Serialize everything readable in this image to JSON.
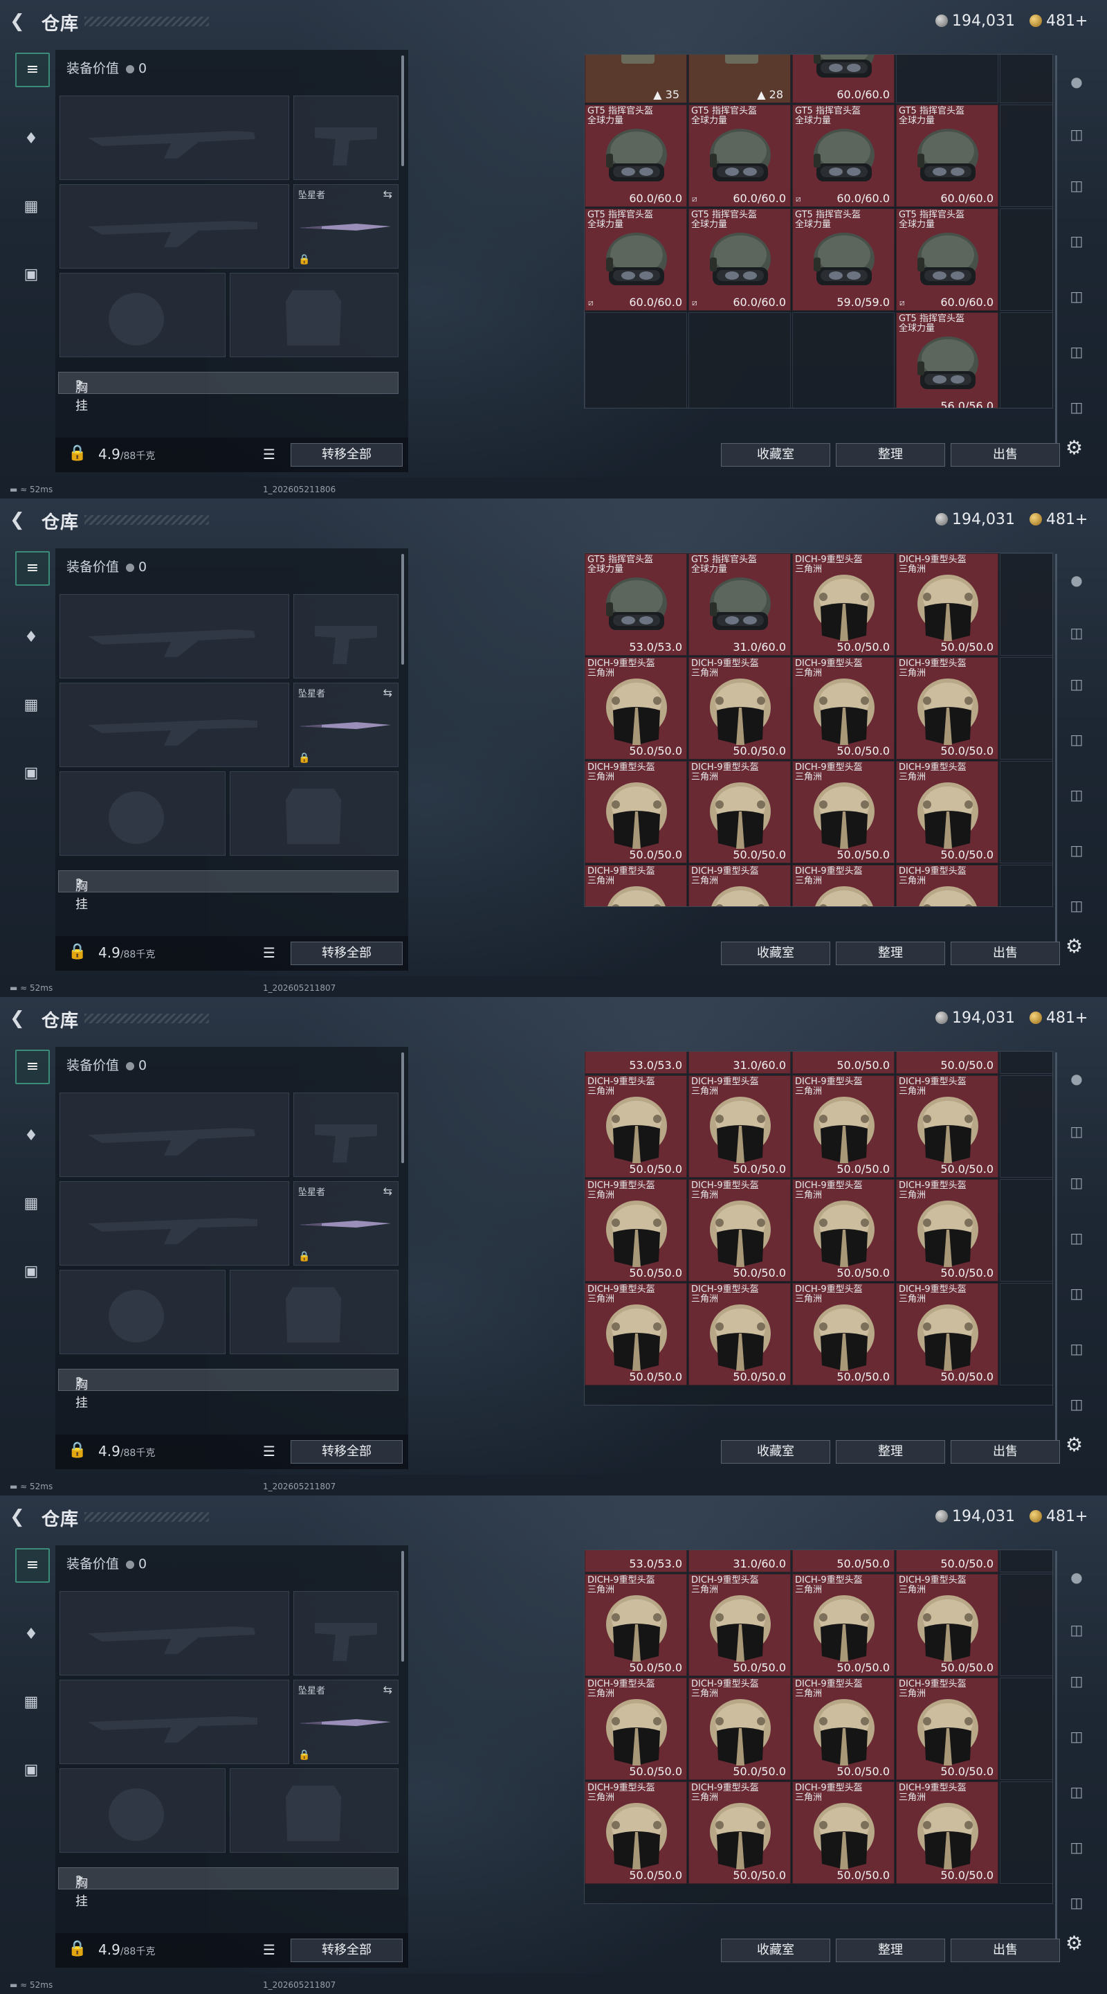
{
  "header": {
    "title": "仓库",
    "currency1": "194,031",
    "currency2": "481+"
  },
  "left": {
    "equip_value_label": "装备价值",
    "equip_value": "0",
    "melee_label": "坠星者",
    "chest_label": "胸挂",
    "chest_mark": "?",
    "weight": "4.9",
    "weight_cap": "/88千克",
    "transfer_all": "转移全部"
  },
  "buttons": {
    "collection": "收藏室",
    "sort": "整理",
    "sell": "出售"
  },
  "status": {
    "ping": "52ms",
    "builds": [
      "1_202605211806",
      "1_202605211807",
      "1_202605211807",
      "1_202605211807"
    ]
  },
  "frames": [
    {
      "top_row": [
        {
          "kind": "top",
          "count": "35"
        },
        {
          "kind": "top",
          "count": "28"
        },
        {
          "kind": "helmet_gt5",
          "name": "",
          "durability": "60.0/60.0"
        },
        {
          "kind": "empty"
        }
      ],
      "rows": [
        [
          {
            "kind": "helmet_gt5",
            "name": "GT5 指挥官头盔\n全球力量",
            "durability": "60.0/60.0",
            "mark": ""
          },
          {
            "kind": "helmet_gt5",
            "name": "GT5 指挥官头盔\n全球力量",
            "durability": "60.0/60.0",
            "mark": "⧄"
          },
          {
            "kind": "helmet_gt5",
            "name": "GT5 指挥官头盔\n全球力量",
            "durability": "60.0/60.0",
            "mark": "⧄"
          },
          {
            "kind": "helmet_gt5",
            "name": "GT5 指挥官头盔\n全球力量",
            "durability": "60.0/60.0",
            "mark": ""
          }
        ],
        [
          {
            "kind": "helmet_gt5",
            "name": "GT5 指挥官头盔\n全球力量",
            "durability": "60.0/60.0",
            "mark": "⧄"
          },
          {
            "kind": "helmet_gt5",
            "name": "GT5 指挥官头盔\n全球力量",
            "durability": "60.0/60.0",
            "mark": "⧄"
          },
          {
            "kind": "helmet_gt5",
            "name": "GT5 指挥官头盔\n全球力量",
            "durability": "59.0/59.0",
            "mark": ""
          },
          {
            "kind": "helmet_gt5",
            "name": "GT5 指挥官头盔\n全球力量",
            "durability": "60.0/60.0",
            "mark": "⧄"
          }
        ],
        [
          {
            "kind": "empty"
          },
          {
            "kind": "empty"
          },
          {
            "kind": "empty"
          },
          {
            "kind": "helmet_gt5",
            "name": "GT5 指挥官头盔\n全球力量",
            "durability": "56.0/56.0",
            "mark": ""
          }
        ]
      ]
    },
    {
      "rows": [
        [
          {
            "kind": "helmet_gt5",
            "name": "GT5 指挥官头盔\n全球力量",
            "durability": "53.0/53.0",
            "mark": ""
          },
          {
            "kind": "helmet_gt5",
            "name": "GT5 指挥官头盔\n全球力量",
            "durability": "31.0/60.0",
            "mark": ""
          },
          {
            "kind": "helmet_dich",
            "name": "DICH-9重型头盔\n三角洲",
            "durability": "50.0/50.0",
            "mark": ""
          },
          {
            "kind": "helmet_dich",
            "name": "DICH-9重型头盔\n三角洲",
            "durability": "50.0/50.0",
            "mark": ""
          }
        ],
        [
          {
            "kind": "helmet_dich",
            "name": "DICH-9重型头盔\n三角洲",
            "durability": "50.0/50.0",
            "mark": ""
          },
          {
            "kind": "helmet_dich",
            "name": "DICH-9重型头盔\n三角洲",
            "durability": "50.0/50.0",
            "mark": ""
          },
          {
            "kind": "helmet_dich",
            "name": "DICH-9重型头盔\n三角洲",
            "durability": "50.0/50.0",
            "mark": ""
          },
          {
            "kind": "helmet_dich",
            "name": "DICH-9重型头盔\n三角洲",
            "durability": "50.0/50.0",
            "mark": ""
          }
        ],
        [
          {
            "kind": "helmet_dich",
            "name": "DICH-9重型头盔\n三角洲",
            "durability": "50.0/50.0",
            "mark": ""
          },
          {
            "kind": "helmet_dich",
            "name": "DICH-9重型头盔\n三角洲",
            "durability": "50.0/50.0",
            "mark": ""
          },
          {
            "kind": "helmet_dich",
            "name": "DICH-9重型头盔\n三角洲",
            "durability": "50.0/50.0",
            "mark": ""
          },
          {
            "kind": "helmet_dich",
            "name": "DICH-9重型头盔\n三角洲",
            "durability": "50.0/50.0",
            "mark": ""
          }
        ],
        [
          {
            "kind": "helmet_dich",
            "name": "DICH-9重型头盔\n三角洲",
            "durability": "",
            "mark": ""
          },
          {
            "kind": "helmet_dich",
            "name": "DICH-9重型头盔\n三角洲",
            "durability": "",
            "mark": ""
          },
          {
            "kind": "helmet_dich",
            "name": "DICH-9重型头盔\n三角洲",
            "durability": "",
            "mark": ""
          },
          {
            "kind": "helmet_dich",
            "name": "DICH-9重型头盔\n三角洲",
            "durability": "",
            "mark": ""
          }
        ]
      ]
    },
    {
      "top_row": [
        {
          "kind": "partial",
          "durability": "53.0/53.0"
        },
        {
          "kind": "partial",
          "durability": "31.0/60.0"
        },
        {
          "kind": "partial",
          "durability": "50.0/50.0"
        },
        {
          "kind": "partial",
          "durability": "50.0/50.0"
        }
      ],
      "rows": [
        [
          {
            "kind": "helmet_dich",
            "name": "DICH-9重型头盔\n三角洲",
            "durability": "50.0/50.0",
            "mark": ""
          },
          {
            "kind": "helmet_dich",
            "name": "DICH-9重型头盔\n三角洲",
            "durability": "50.0/50.0",
            "mark": ""
          },
          {
            "kind": "helmet_dich",
            "name": "DICH-9重型头盔\n三角洲",
            "durability": "50.0/50.0",
            "mark": ""
          },
          {
            "kind": "helmet_dich",
            "name": "DICH-9重型头盔\n三角洲",
            "durability": "50.0/50.0",
            "mark": ""
          }
        ],
        [
          {
            "kind": "helmet_dich",
            "name": "DICH-9重型头盔\n三角洲",
            "durability": "50.0/50.0",
            "mark": ""
          },
          {
            "kind": "helmet_dich",
            "name": "DICH-9重型头盔\n三角洲",
            "durability": "50.0/50.0",
            "mark": ""
          },
          {
            "kind": "helmet_dich",
            "name": "DICH-9重型头盔\n三角洲",
            "durability": "50.0/50.0",
            "mark": ""
          },
          {
            "kind": "helmet_dich",
            "name": "DICH-9重型头盔\n三角洲",
            "durability": "50.0/50.0",
            "mark": ""
          }
        ],
        [
          {
            "kind": "helmet_dich",
            "name": "DICH-9重型头盔\n三角洲",
            "durability": "50.0/50.0",
            "mark": ""
          },
          {
            "kind": "helmet_dich",
            "name": "DICH-9重型头盔\n三角洲",
            "durability": "50.0/50.0",
            "mark": ""
          },
          {
            "kind": "helmet_dich",
            "name": "DICH-9重型头盔\n三角洲",
            "durability": "50.0/50.0",
            "mark": ""
          },
          {
            "kind": "helmet_dich",
            "name": "DICH-9重型头盔\n三角洲",
            "durability": "50.0/50.0",
            "mark": ""
          }
        ]
      ]
    },
    {
      "top_row": [
        {
          "kind": "partial",
          "durability": "53.0/53.0"
        },
        {
          "kind": "partial",
          "durability": "31.0/60.0"
        },
        {
          "kind": "partial",
          "durability": "50.0/50.0"
        },
        {
          "kind": "partial",
          "durability": "50.0/50.0"
        }
      ],
      "rows": [
        [
          {
            "kind": "helmet_dich",
            "name": "DICH-9重型头盔\n三角洲",
            "durability": "50.0/50.0",
            "mark": ""
          },
          {
            "kind": "helmet_dich",
            "name": "DICH-9重型头盔\n三角洲",
            "durability": "50.0/50.0",
            "mark": ""
          },
          {
            "kind": "helmet_dich",
            "name": "DICH-9重型头盔\n三角洲",
            "durability": "50.0/50.0",
            "mark": ""
          },
          {
            "kind": "helmet_dich",
            "name": "DICH-9重型头盔\n三角洲",
            "durability": "50.0/50.0",
            "mark": ""
          }
        ],
        [
          {
            "kind": "helmet_dich",
            "name": "DICH-9重型头盔\n三角洲",
            "durability": "50.0/50.0",
            "mark": ""
          },
          {
            "kind": "helmet_dich",
            "name": "DICH-9重型头盔\n三角洲",
            "durability": "50.0/50.0",
            "mark": ""
          },
          {
            "kind": "helmet_dich",
            "name": "DICH-9重型头盔\n三角洲",
            "durability": "50.0/50.0",
            "mark": ""
          },
          {
            "kind": "helmet_dich",
            "name": "DICH-9重型头盔\n三角洲",
            "durability": "50.0/50.0",
            "mark": ""
          }
        ],
        [
          {
            "kind": "helmet_dich",
            "name": "DICH-9重型头盔\n三角洲",
            "durability": "50.0/50.0",
            "mark": ""
          },
          {
            "kind": "helmet_dich",
            "name": "DICH-9重型头盔\n三角洲",
            "durability": "50.0/50.0",
            "mark": ""
          },
          {
            "kind": "helmet_dich",
            "name": "DICH-9重型头盔\n三角洲",
            "durability": "50.0/50.0",
            "mark": ""
          },
          {
            "kind": "helmet_dich",
            "name": "DICH-9重型头盔\n三角洲",
            "durability": "50.0/50.0",
            "mark": ""
          }
        ]
      ]
    }
  ]
}
